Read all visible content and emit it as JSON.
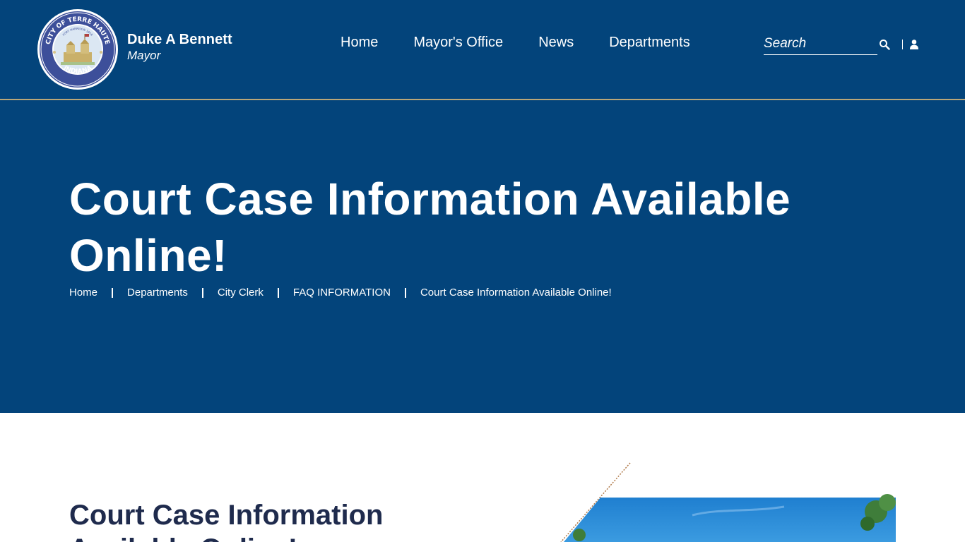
{
  "header": {
    "seal_text_top": "CITY OF TERRE HAUTE",
    "seal_text_bottom": "INDIANA",
    "seal_text_inner": "FORT HARRISON 1816",
    "brand_name": "Duke A Bennett",
    "brand_role": "Mayor",
    "nav": [
      {
        "label": "Home"
      },
      {
        "label": "Mayor's Office"
      },
      {
        "label": "News"
      },
      {
        "label": "Departments"
      }
    ],
    "search": {
      "placeholder": "Search",
      "value": ""
    },
    "icons": {
      "search": "search-icon",
      "user": "user-icon"
    }
  },
  "hero": {
    "title": "Court Case Information Available Online!",
    "breadcrumb": [
      "Home",
      "Departments",
      "City Clerk",
      "FAQ INFORMATION",
      "Court Case Information Available Online!"
    ]
  },
  "content": {
    "title": "Court Case Information Available Online!"
  },
  "colors": {
    "brand_blue": "#03447b",
    "accent_gold": "#b9a678",
    "heading_dark": "#1f2b4d"
  }
}
